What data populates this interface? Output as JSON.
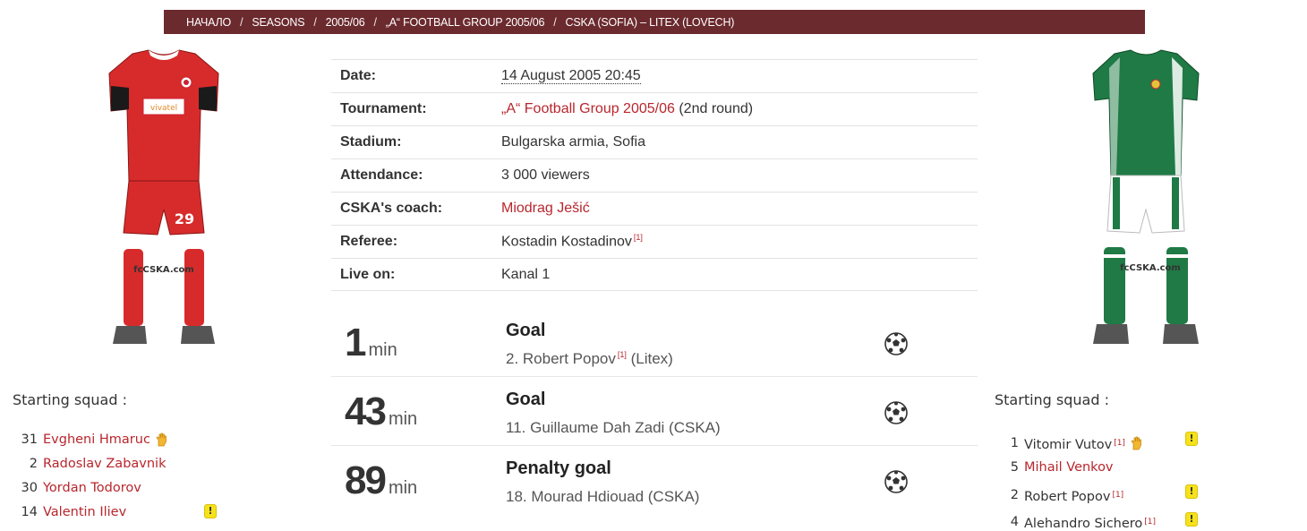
{
  "breadcrumb": {
    "items": [
      "НАЧАЛО",
      "SEASONS",
      "2005/06",
      "„A“ FOOTBALL GROUP 2005/06",
      "CSKA (SOFIA) – LITEX (LOVECH)"
    ],
    "separator": "/"
  },
  "kits": {
    "home": {
      "shirt_color": "#d72b2b",
      "number": "29",
      "brand": "fcCSKA.com",
      "sponsor": "vivatel"
    },
    "away": {
      "shirt_color": "#1f7a45",
      "brand": "fcCSKA.com"
    }
  },
  "info": {
    "date_label": "Date:",
    "date_value": "14 August 2005 20:45",
    "tournament_label": "Tournament:",
    "tournament_link": "„A“ Football Group 2005/06",
    "tournament_round": "(2nd round)",
    "stadium_label": "Stadium:",
    "stadium_value": "Bulgarska armia, Sofia",
    "attendance_label": "Attendance:",
    "attendance_value": "3 000 viewers",
    "coach_label": "CSKA's coach:",
    "coach_value": "Miodrag Ješić",
    "referee_label": "Referee:",
    "referee_value": "Kostadin Kostadinov",
    "referee_ref": "[1]",
    "live_label": "Live on:",
    "live_value": "Kanal 1"
  },
  "events": [
    {
      "minute": "1",
      "unit": "min",
      "type": "Goal",
      "desc_pre": "2. Robert Popov",
      "ref": "[1]",
      "desc_post": " (Litex)",
      "icon": "football-icon"
    },
    {
      "minute": "43",
      "unit": "min",
      "type": "Goal",
      "desc_pre": "11. Guillaume Dah Zadi (CSKA)",
      "ref": "",
      "desc_post": "",
      "icon": "football-icon"
    },
    {
      "minute": "89",
      "unit": "min",
      "type": "Penalty goal",
      "desc_pre": "18. Mourad Hdiouad (CSKA)",
      "ref": "",
      "desc_post": "",
      "icon": "football-icon"
    }
  ],
  "home_squad": {
    "title": "Starting squad :",
    "players": [
      {
        "num": "31",
        "name": "Evgheni Hmaruc",
        "keeper": true,
        "yellow": false
      },
      {
        "num": "2",
        "name": "Radoslav Zabavnik",
        "keeper": false,
        "yellow": false
      },
      {
        "num": "30",
        "name": "Yordan Todorov",
        "keeper": false,
        "yellow": false
      },
      {
        "num": "14",
        "name": "Valentin Iliev",
        "keeper": false,
        "yellow": true
      }
    ]
  },
  "away_squad": {
    "title": "Starting squad :",
    "players": [
      {
        "num": "1",
        "name": "Vitomir Vutov",
        "ref": "[1]",
        "keeper": true,
        "yellow": true
      },
      {
        "num": "5",
        "name": "Mihail Venkov",
        "ref": "",
        "keeper": false,
        "yellow": false
      },
      {
        "num": "2",
        "name": "Robert Popov",
        "ref": "[1]",
        "keeper": false,
        "yellow": true
      },
      {
        "num": "4",
        "name": "Alehandro Sichero",
        "ref": "[1]",
        "keeper": false,
        "yellow": true
      }
    ]
  },
  "colors": {
    "accent": "#b8262d",
    "breadcrumb_bg": "#6b2a2e",
    "card_yellow": "#f6e21a"
  },
  "icons": {
    "card": "!",
    "keeper": "goalkeeper-glove-icon",
    "ball": "football-icon"
  }
}
